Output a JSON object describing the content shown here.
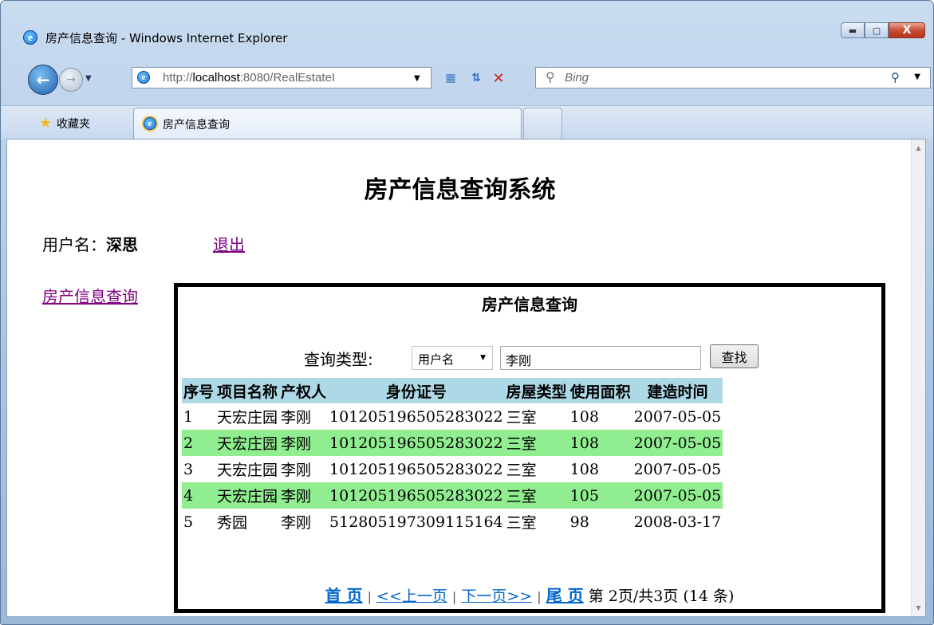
{
  "window": {
    "title": "房产信息查询 - Windows Internet Explorer",
    "min_glyph": "▬",
    "max_glyph": "▢",
    "close_glyph": "X"
  },
  "address": {
    "prefix": "http://",
    "host": "localhost",
    "rest": ":8080/RealEstateI",
    "search_placeholder": "Bing"
  },
  "favorites": {
    "label": "收藏夹"
  },
  "tab": {
    "label": "房产信息查询"
  },
  "page": {
    "heading": "房产信息查询系统",
    "user_label": "用户名：",
    "user_name": "深思",
    "logout": "退出",
    "nav_link": "房产信息查询"
  },
  "panel": {
    "title": "房产信息查询",
    "query_label": "查询类型:",
    "query_type": "用户名",
    "query_value": "李刚",
    "search_button": "查找",
    "columns": [
      "序号",
      "项目名称",
      "产权人",
      "身份证号",
      "房屋类型",
      "使用面积",
      "建造时间"
    ],
    "rows": [
      [
        "1",
        "天宏庄园",
        "李刚",
        "101205196505283022",
        "三室",
        "108",
        "2007-05-05"
      ],
      [
        "2",
        "天宏庄园",
        "李刚",
        "101205196505283022",
        "三室",
        "108",
        "2007-05-05"
      ],
      [
        "3",
        "天宏庄园",
        "李刚",
        "101205196505283022",
        "三室",
        "108",
        "2007-05-05"
      ],
      [
        "4",
        "天宏庄园",
        "李刚",
        "101205196505283022",
        "三室",
        "105",
        "2007-05-05"
      ],
      [
        "5",
        "秀园",
        "李刚",
        "512805197309115164",
        "三室",
        "98",
        "2008-03-17"
      ]
    ],
    "pager": {
      "first": "首 页",
      "prev": "<<上一页",
      "next": "下一页>>",
      "last": "尾 页",
      "status": "第 2页/共3页 (14 条)"
    }
  }
}
